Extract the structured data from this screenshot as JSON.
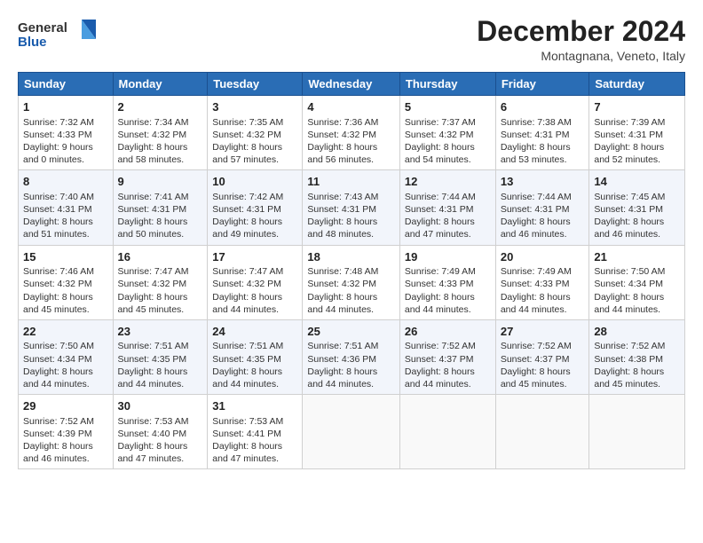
{
  "header": {
    "logo_line1": "General",
    "logo_line2": "Blue",
    "month": "December 2024",
    "location": "Montagnana, Veneto, Italy"
  },
  "weekdays": [
    "Sunday",
    "Monday",
    "Tuesday",
    "Wednesday",
    "Thursday",
    "Friday",
    "Saturday"
  ],
  "weeks": [
    [
      {
        "day": "1",
        "info": "Sunrise: 7:32 AM\nSunset: 4:33 PM\nDaylight: 9 hours\nand 0 minutes."
      },
      {
        "day": "2",
        "info": "Sunrise: 7:34 AM\nSunset: 4:32 PM\nDaylight: 8 hours\nand 58 minutes."
      },
      {
        "day": "3",
        "info": "Sunrise: 7:35 AM\nSunset: 4:32 PM\nDaylight: 8 hours\nand 57 minutes."
      },
      {
        "day": "4",
        "info": "Sunrise: 7:36 AM\nSunset: 4:32 PM\nDaylight: 8 hours\nand 56 minutes."
      },
      {
        "day": "5",
        "info": "Sunrise: 7:37 AM\nSunset: 4:32 PM\nDaylight: 8 hours\nand 54 minutes."
      },
      {
        "day": "6",
        "info": "Sunrise: 7:38 AM\nSunset: 4:31 PM\nDaylight: 8 hours\nand 53 minutes."
      },
      {
        "day": "7",
        "info": "Sunrise: 7:39 AM\nSunset: 4:31 PM\nDaylight: 8 hours\nand 52 minutes."
      }
    ],
    [
      {
        "day": "8",
        "info": "Sunrise: 7:40 AM\nSunset: 4:31 PM\nDaylight: 8 hours\nand 51 minutes."
      },
      {
        "day": "9",
        "info": "Sunrise: 7:41 AM\nSunset: 4:31 PM\nDaylight: 8 hours\nand 50 minutes."
      },
      {
        "day": "10",
        "info": "Sunrise: 7:42 AM\nSunset: 4:31 PM\nDaylight: 8 hours\nand 49 minutes."
      },
      {
        "day": "11",
        "info": "Sunrise: 7:43 AM\nSunset: 4:31 PM\nDaylight: 8 hours\nand 48 minutes."
      },
      {
        "day": "12",
        "info": "Sunrise: 7:44 AM\nSunset: 4:31 PM\nDaylight: 8 hours\nand 47 minutes."
      },
      {
        "day": "13",
        "info": "Sunrise: 7:44 AM\nSunset: 4:31 PM\nDaylight: 8 hours\nand 46 minutes."
      },
      {
        "day": "14",
        "info": "Sunrise: 7:45 AM\nSunset: 4:31 PM\nDaylight: 8 hours\nand 46 minutes."
      }
    ],
    [
      {
        "day": "15",
        "info": "Sunrise: 7:46 AM\nSunset: 4:32 PM\nDaylight: 8 hours\nand 45 minutes."
      },
      {
        "day": "16",
        "info": "Sunrise: 7:47 AM\nSunset: 4:32 PM\nDaylight: 8 hours\nand 45 minutes."
      },
      {
        "day": "17",
        "info": "Sunrise: 7:47 AM\nSunset: 4:32 PM\nDaylight: 8 hours\nand 44 minutes."
      },
      {
        "day": "18",
        "info": "Sunrise: 7:48 AM\nSunset: 4:32 PM\nDaylight: 8 hours\nand 44 minutes."
      },
      {
        "day": "19",
        "info": "Sunrise: 7:49 AM\nSunset: 4:33 PM\nDaylight: 8 hours\nand 44 minutes."
      },
      {
        "day": "20",
        "info": "Sunrise: 7:49 AM\nSunset: 4:33 PM\nDaylight: 8 hours\nand 44 minutes."
      },
      {
        "day": "21",
        "info": "Sunrise: 7:50 AM\nSunset: 4:34 PM\nDaylight: 8 hours\nand 44 minutes."
      }
    ],
    [
      {
        "day": "22",
        "info": "Sunrise: 7:50 AM\nSunset: 4:34 PM\nDaylight: 8 hours\nand 44 minutes."
      },
      {
        "day": "23",
        "info": "Sunrise: 7:51 AM\nSunset: 4:35 PM\nDaylight: 8 hours\nand 44 minutes."
      },
      {
        "day": "24",
        "info": "Sunrise: 7:51 AM\nSunset: 4:35 PM\nDaylight: 8 hours\nand 44 minutes."
      },
      {
        "day": "25",
        "info": "Sunrise: 7:51 AM\nSunset: 4:36 PM\nDaylight: 8 hours\nand 44 minutes."
      },
      {
        "day": "26",
        "info": "Sunrise: 7:52 AM\nSunset: 4:37 PM\nDaylight: 8 hours\nand 44 minutes."
      },
      {
        "day": "27",
        "info": "Sunrise: 7:52 AM\nSunset: 4:37 PM\nDaylight: 8 hours\nand 45 minutes."
      },
      {
        "day": "28",
        "info": "Sunrise: 7:52 AM\nSunset: 4:38 PM\nDaylight: 8 hours\nand 45 minutes."
      }
    ],
    [
      {
        "day": "29",
        "info": "Sunrise: 7:52 AM\nSunset: 4:39 PM\nDaylight: 8 hours\nand 46 minutes."
      },
      {
        "day": "30",
        "info": "Sunrise: 7:53 AM\nSunset: 4:40 PM\nDaylight: 8 hours\nand 47 minutes."
      },
      {
        "day": "31",
        "info": "Sunrise: 7:53 AM\nSunset: 4:41 PM\nDaylight: 8 hours\nand 47 minutes."
      },
      null,
      null,
      null,
      null
    ]
  ]
}
